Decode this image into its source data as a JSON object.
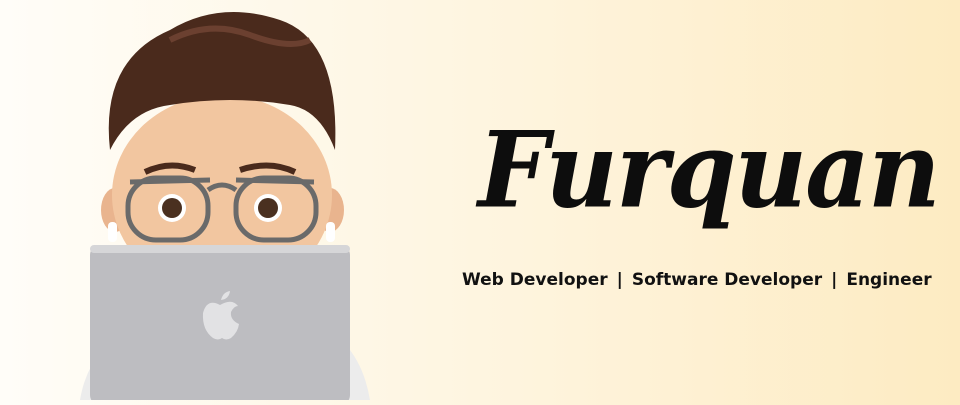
{
  "brand": {
    "name": "Furquan"
  },
  "tagline": {
    "items": [
      "Web Developer",
      "Software Developer",
      "Engineer"
    ],
    "separator": "|"
  },
  "avatar": {
    "icon": "memoji-with-laptop"
  }
}
